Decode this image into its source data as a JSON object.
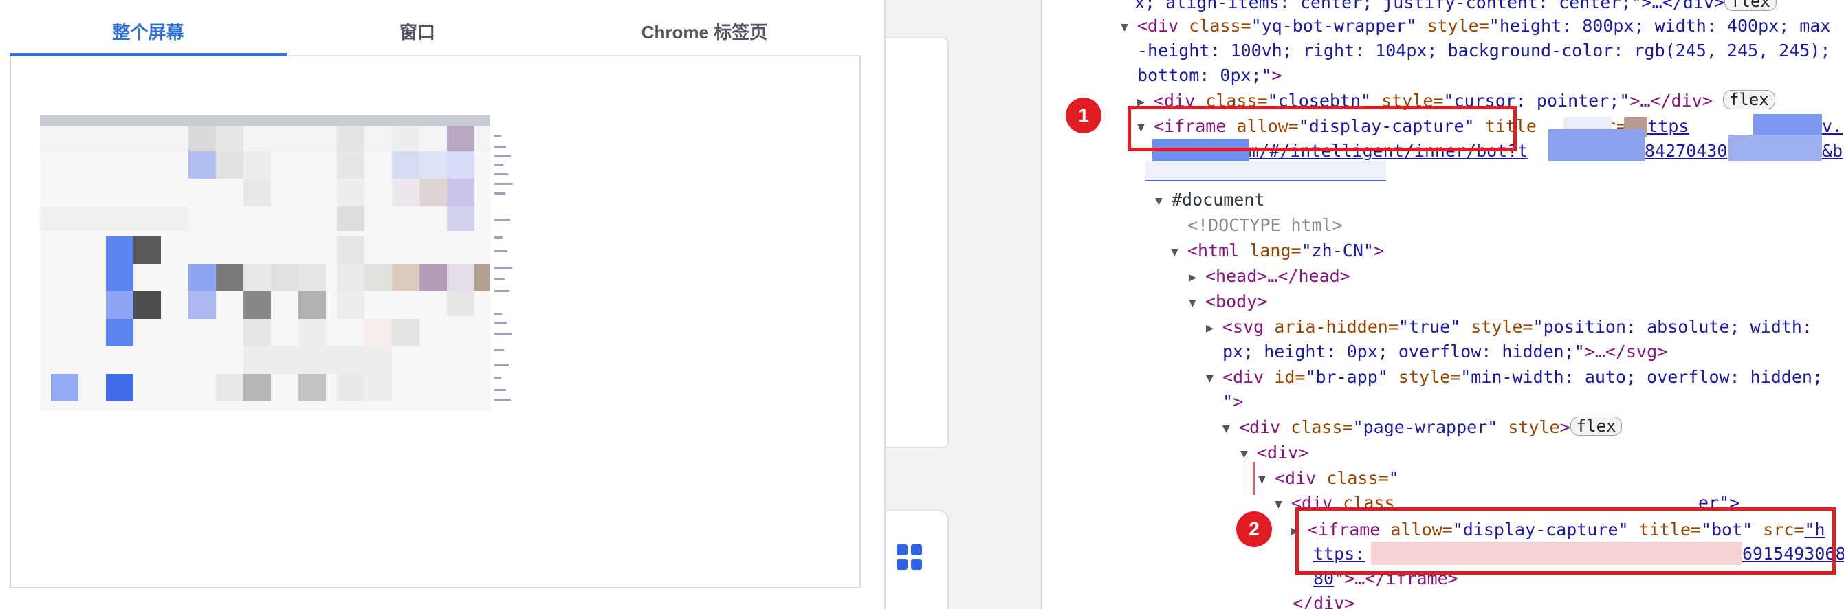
{
  "picker": {
    "tabs": [
      {
        "label": "整个屏幕",
        "active": true
      },
      {
        "label": "窗口",
        "active": false
      },
      {
        "label": "Chrome 标签页",
        "active": false
      }
    ],
    "preview_name": "整个屏幕"
  },
  "middle": {
    "apps_icon": "apps-grid-icon"
  },
  "devtools": {
    "lines": {
      "l0_text": "x; align-items: center; justify-content: center;\">…</div>",
      "l0_badge": "flex",
      "l1_tag_open": "<div",
      "l1_attr1": " class=",
      "l1_val1": "\"yq-bot-wrapper\"",
      "l1_attr2": " style=",
      "l1_val2": "\"height: 800px; width: 400px; max",
      "l2_val": "-height: 100vh; right: 104px; background-color: rgb(245, 245, 245);",
      "l3_val": "bottom: 0px;\"",
      "l3_tag": ">",
      "l4_tag": "<div",
      "l4_attr": " class=",
      "l4_val": "\"closebtn\"",
      "l4_attr2": " style=",
      "l4_val2": "\"cursor: pointer;\"",
      "l4_tag2": ">…</div>",
      "l4_badge": "flex",
      "l5_tag": "<iframe",
      "l5_attr1": " allow=",
      "l5_val1": "\"display-capture\"",
      "l5_attr2": " title",
      "l5_attr3": "c=",
      "l5_link": "\"https",
      "l5_link2": "v.",
      "l6_link": "m/#/intelligent/inner/bot?t",
      "l6_link2": "84270430",
      "l6_link3": "&b",
      "l7_tri": "▼",
      "l7_text": "#document",
      "l8_text": "<!DOCTYPE html>",
      "l9_tag": "<html",
      "l9_attr": " lang=",
      "l9_val": "\"zh-CN\"",
      "l9_tag2": ">",
      "l10_tag": "<head>…</head>",
      "l11_tag": "<body>",
      "l12_tag": "<svg",
      "l12_attr1": " aria-hidden=",
      "l12_val1": "\"true\"",
      "l12_attr2": " style=",
      "l12_val2": "\"position: absolute; width:",
      "l13_val": "px; height: 0px; overflow: hidden;\"",
      "l13_tag": ">…</svg>",
      "l14_tag": "<div",
      "l14_attr1": " id=",
      "l14_val1": "\"br-app\"",
      "l14_attr2": " style=",
      "l14_val2": "\"min-width: auto; overflow: hidden;",
      "l15_val": "\"",
      "l15_tag": ">",
      "l16_tag": "<div",
      "l16_attr1": " class=",
      "l16_val1": "\"page-wrapper\"",
      "l16_attr2": " style",
      "l16_tag2": ">",
      "l16_badge": "flex",
      "l17_tag": "<div>",
      "l18_tag": "<div",
      "l18_attr": " class=",
      "l18_val": "\"",
      "l19_tag": "<div",
      "l19_attr": " class",
      "l19_tail": "er\">",
      "l20_tag": "<iframe",
      "l20_attr1": " allow=",
      "l20_val1": "\"display-capture\"",
      "l20_attr2": " title=",
      "l20_val2": "\"bot\"",
      "l20_attr3": " src=",
      "l20_link": "\"h",
      "l21_link": "ttps:",
      "l21_link2": "6915493068",
      "l22_link": "80",
      "l22_tag": "\">…</iframe>",
      "l23_tag": "</div>"
    },
    "annotations": [
      {
        "label": "1"
      },
      {
        "label": "2"
      }
    ],
    "colors": {
      "annotation_red": "#e21c23",
      "redaction_blue": "#6f8ff0",
      "redaction_pink": "#f6d3d3"
    }
  }
}
